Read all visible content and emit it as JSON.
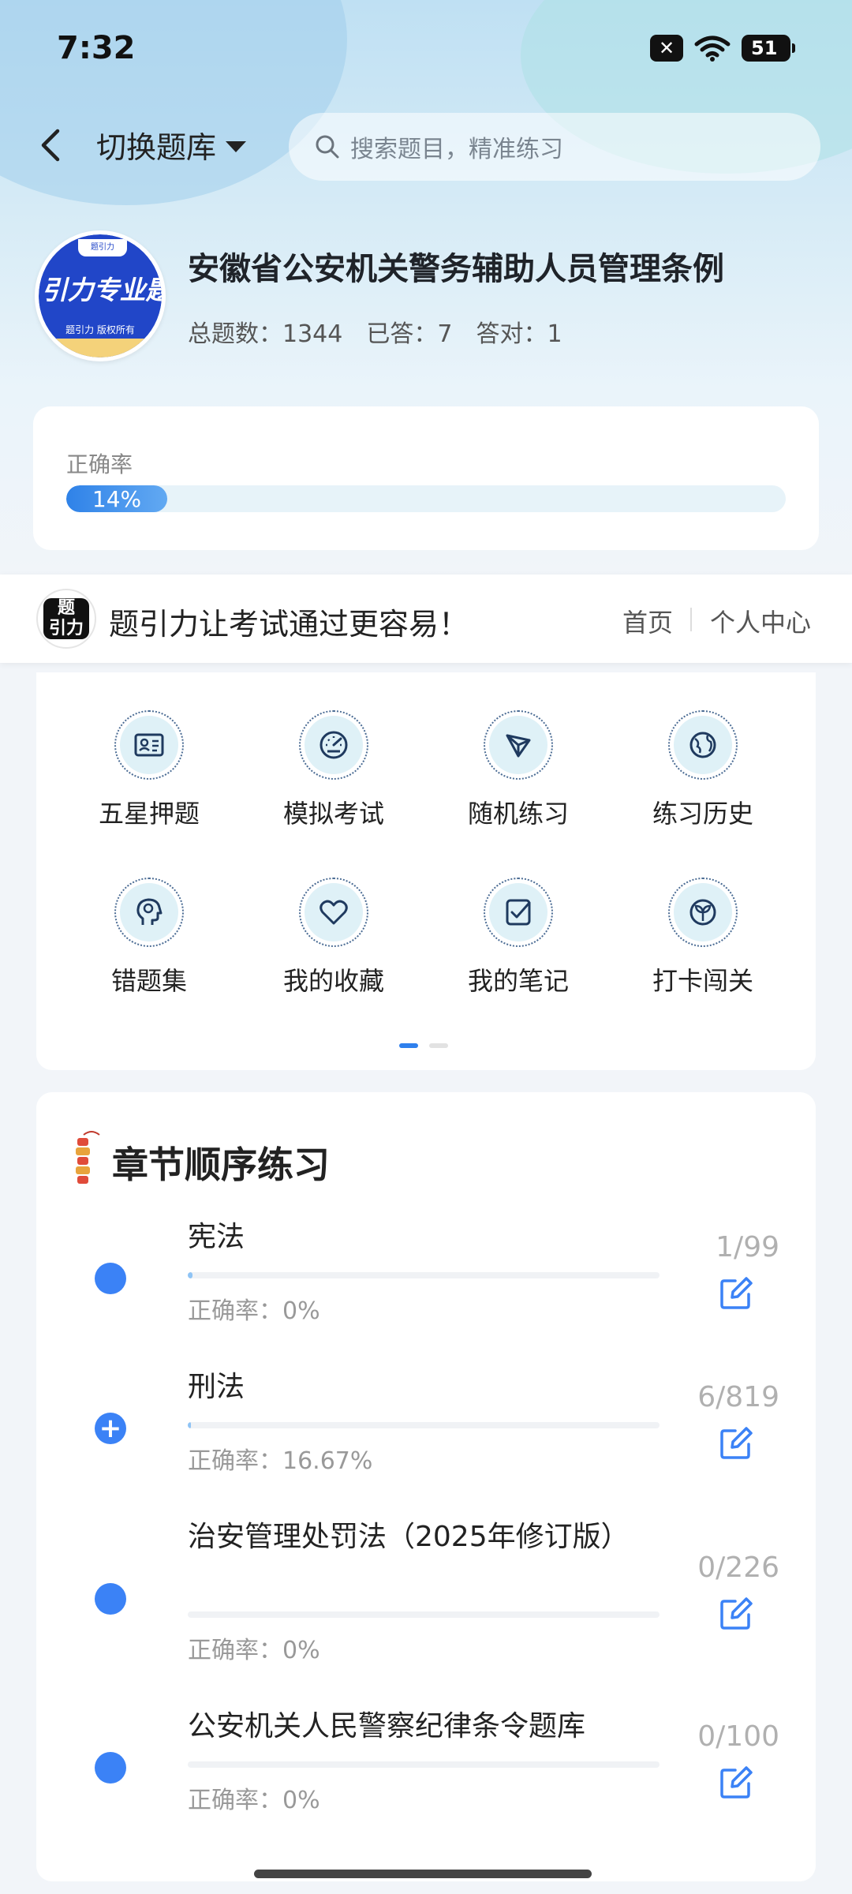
{
  "status_bar": {
    "time": "7:32",
    "notif_icon": "close-box-icon",
    "battery": "51"
  },
  "header": {
    "back_icon": "chevron-left-icon",
    "switch_label": "切换题库",
    "search_placeholder": "搜索题目，精准练习"
  },
  "bank": {
    "logo_main": "引力专业题",
    "logo_sub": "题引力 版权所有",
    "logo_top": "题引力",
    "title": "安徽省公安机关警务辅助人员管理条例",
    "total": "总题数：1344",
    "answered": "已答：7",
    "correct": "答对：1"
  },
  "accuracy": {
    "label": "正确率",
    "value_text": "14%",
    "value": 0.14
  },
  "promo": {
    "logo_text": "题引力",
    "slogan": "题引力让考试通过更容易！",
    "home": "首页",
    "personal": "个人中心"
  },
  "functions": [
    {
      "label": "五星押题",
      "icon": "id-card-icon"
    },
    {
      "label": "模拟考试",
      "icon": "speedometer-icon"
    },
    {
      "label": "随机练习",
      "icon": "network-icon"
    },
    {
      "label": "练习历史",
      "icon": "globe-icon"
    },
    {
      "label": "错题集",
      "icon": "head-icon"
    },
    {
      "label": "我的收藏",
      "icon": "heart-icon"
    },
    {
      "label": "我的笔记",
      "icon": "checked-note-icon"
    },
    {
      "label": "打卡闯关",
      "icon": "sprout-icon"
    }
  ],
  "carousel": {
    "pages": 2,
    "active": 0
  },
  "chapters": {
    "title": "章节顺序练习",
    "items": [
      {
        "name": "宪法",
        "accuracy": "正确率：0%",
        "count": "1/99",
        "progress": 0.0101,
        "bullet": "dot"
      },
      {
        "name": "刑法",
        "accuracy": "正确率：16.67%",
        "count": "6/819",
        "progress": 0.0073,
        "bullet": "plus"
      },
      {
        "name": "治安管理处罚法（2025年修订版）",
        "accuracy": "正确率：0%",
        "count": "0/226",
        "progress": 0,
        "bullet": "dot"
      },
      {
        "name": "公安机关人民警察纪律条令题库",
        "accuracy": "正确率：0%",
        "count": "0/100",
        "progress": 0,
        "bullet": "dot"
      }
    ]
  },
  "colors": {
    "accent": "#3b82f6",
    "progress": "#2f82e8",
    "icon_bg": "#dff1f7"
  }
}
